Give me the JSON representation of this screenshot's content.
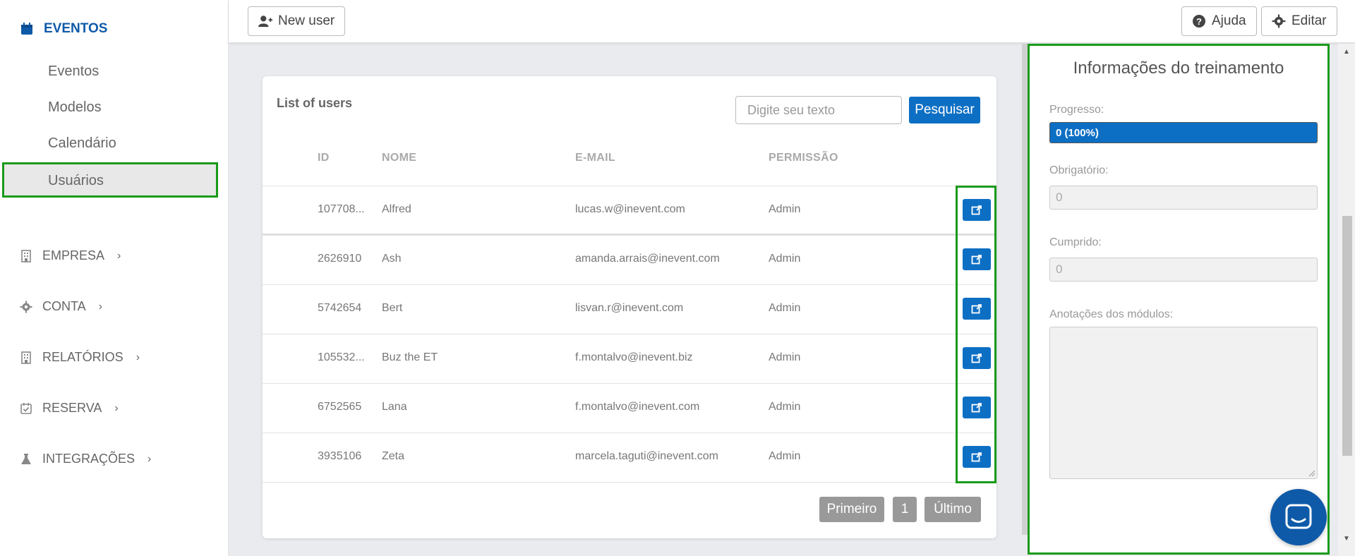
{
  "sidebar": {
    "header": "EVENTOS",
    "items": [
      "Eventos",
      "Modelos",
      "Calendário",
      "Usuários"
    ],
    "sections": [
      "EMPRESA",
      "CONTA",
      "RELATÓRIOS",
      "RESERVA",
      "INTEGRAÇÕES"
    ]
  },
  "toolbar": {
    "new_user": "New user",
    "help": "Ajuda",
    "edit": "Editar"
  },
  "users_card": {
    "title": "List of users",
    "search_placeholder": "Digite seu texto",
    "search_button": "Pesquisar",
    "columns": [
      "ID",
      "NOME",
      "E-MAIL",
      "PERMISSÃO"
    ],
    "rows": [
      {
        "id": "107708...",
        "name": "Alfred",
        "email": "lucas.w@inevent.com",
        "permission": "Admin"
      },
      {
        "id": "2626910",
        "name": "Ash",
        "email": "amanda.arrais@inevent.com",
        "permission": "Admin"
      },
      {
        "id": "5742654",
        "name": "Bert",
        "email": "lisvan.r@inevent.com",
        "permission": "Admin"
      },
      {
        "id": "105532...",
        "name": "Buz the ET",
        "email": "f.montalvo@inevent.biz",
        "permission": "Admin"
      },
      {
        "id": "6752565",
        "name": "Lana",
        "email": "f.montalvo@inevent.com",
        "permission": "Admin"
      },
      {
        "id": "3935106",
        "name": "Zeta",
        "email": "marcela.taguti@inevent.com",
        "permission": "Admin"
      }
    ],
    "pagination": {
      "first": "Primeiro",
      "page": "1",
      "last": "Último"
    }
  },
  "training": {
    "title": "Informações do treinamento",
    "progress_label": "Progresso:",
    "progress_value": "0 (100%)",
    "progress_fraction": 1.0,
    "required_label": "Obrigatório:",
    "required_value": "0",
    "completed_label": "Cumprido:",
    "completed_value": "0",
    "notes_label": "Anotações dos módulos:"
  },
  "colors": {
    "accent": "#0d6fc4",
    "nav": "#0f5aa8",
    "highlight": "#1a9a1a"
  }
}
